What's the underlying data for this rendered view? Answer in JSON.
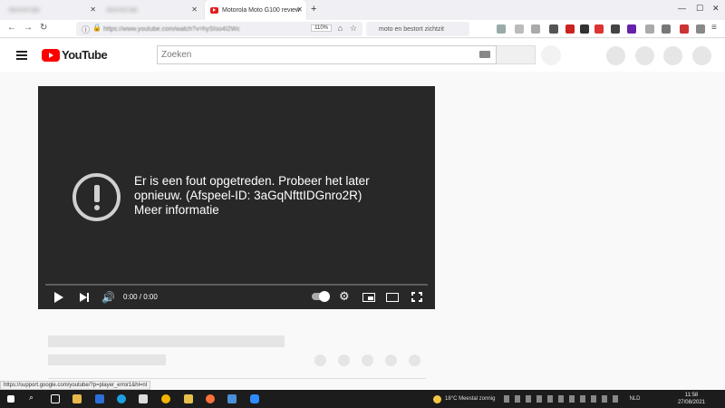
{
  "browser": {
    "tabs": [
      {
        "label": "blurred tab",
        "state": "blurred"
      },
      {
        "label": "blurred tab",
        "state": "blurred"
      },
      {
        "label": "Motorola Moto G100 review",
        "state": "active"
      }
    ],
    "url": "https://www.youtube.com/watch?v=hySIso4I2Wc",
    "zoom": "110%",
    "search_text": "moto en bestort zichtzit",
    "status_url": "https://support.google.com/youtube/?p=player_error1&hl=nl"
  },
  "youtube": {
    "logo_text": "YouTube",
    "search_placeholder": "Zoeken"
  },
  "player": {
    "error_line1": "Er is een fout opgetreden. Probeer het later",
    "error_line2": "opnieuw. (Afspeel-ID: 3aGqNfttIDGnro2R)",
    "error_more": "Meer informatie",
    "time": "0:00 / 0:00"
  },
  "taskbar": {
    "weather": "18°C  Meestal zonnig",
    "lang": "NLD",
    "time": "11:58",
    "date": "27/08/2021"
  },
  "colors": {
    "youtube_red": "#ff0000",
    "player_bg": "#282828"
  }
}
